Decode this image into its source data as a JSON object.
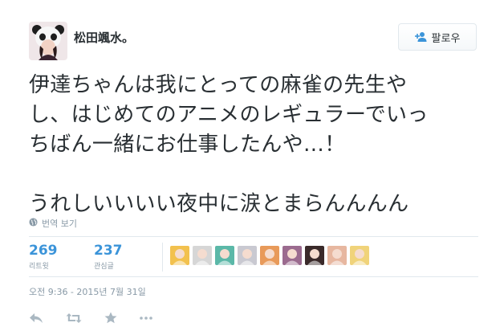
{
  "tweet": {
    "author": {
      "display_name": "松田颯水。",
      "avatar_icon": "avatar-panda-hood"
    },
    "follow_button": {
      "label": "팔로우",
      "icon": "add-user-icon"
    },
    "text_lines": [
      "伊達ちゃんは我にとっての麻雀の先生や",
      "し、はじめてのアニメのレギュラーでいっ",
      "ちばん一緒にお仕事したんや…！",
      "",
      "うれしいいいい夜中に涙とまらんんんん"
    ],
    "translate_label": "번역 보기",
    "stats": {
      "retweets": {
        "count": "269",
        "label": "리트윗"
      },
      "favorites": {
        "count": "237",
        "label": "관심글"
      }
    },
    "favoriters": [
      {
        "name": "favoriter-1",
        "color": "#f2c14e"
      },
      {
        "name": "favoriter-2",
        "color": "#d6d6d6"
      },
      {
        "name": "favoriter-3",
        "color": "#5bb8a8"
      },
      {
        "name": "favoriter-4",
        "color": "#c9c9d1"
      },
      {
        "name": "favoriter-5",
        "color": "#e89a5a"
      },
      {
        "name": "favoriter-6",
        "color": "#9b6b8f"
      },
      {
        "name": "favoriter-7",
        "color": "#3a2a2a"
      },
      {
        "name": "favoriter-8",
        "color": "#e7b7a0"
      },
      {
        "name": "favoriter-9",
        "color": "#f0d37a"
      }
    ],
    "timestamp": "오전 9:36 - 2015년 7월 31일",
    "actions": [
      "reply-icon",
      "retweet-icon",
      "favorite-icon",
      "more-icon"
    ],
    "colors": {
      "link": "#3b94d9",
      "muted": "#8899a6",
      "text": "#292f33",
      "border": "#e1e8ed"
    }
  }
}
